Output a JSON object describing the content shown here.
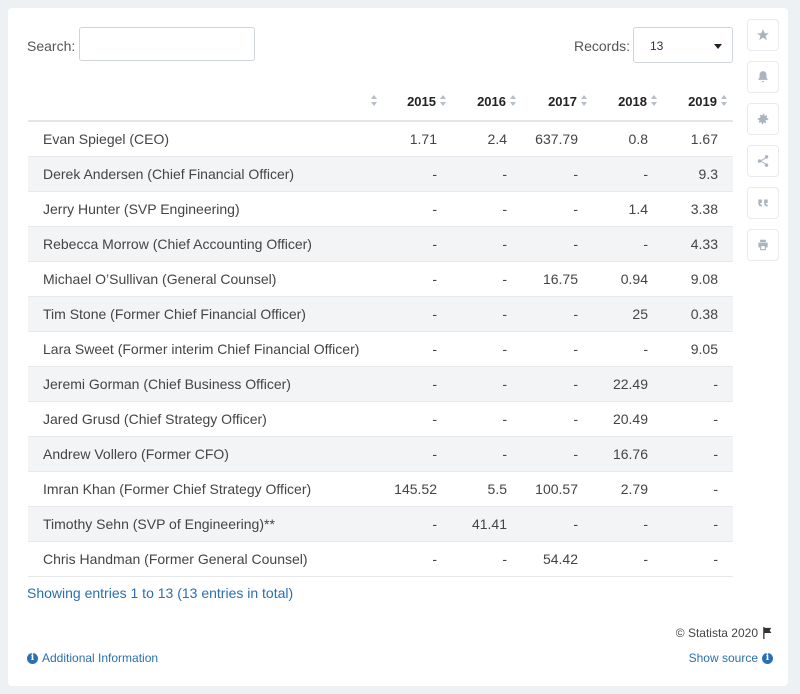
{
  "search": {
    "label": "Search:",
    "value": ""
  },
  "records": {
    "label": "Records:",
    "selected": "13"
  },
  "sidebar": {
    "icons": [
      "star-icon",
      "bell-icon",
      "gear-icon",
      "share-icon",
      "quote-icon",
      "print-icon"
    ]
  },
  "chart_data": {
    "type": "table",
    "columns": [
      "",
      "2015",
      "2016",
      "2017",
      "2018",
      "2019"
    ],
    "rows": [
      [
        "Evan Spiegel (CEO)",
        "1.71",
        "2.4",
        "637.79",
        "0.8",
        "1.67"
      ],
      [
        "Derek Andersen (Chief Financial Officer)",
        "-",
        "-",
        "-",
        "-",
        "9.3"
      ],
      [
        "Jerry Hunter (SVP Engineering)",
        "-",
        "-",
        "-",
        "1.4",
        "3.38"
      ],
      [
        "Rebecca Morrow (Chief Accounting Officer)",
        "-",
        "-",
        "-",
        "-",
        "4.33"
      ],
      [
        "Michael O’Sullivan (General Counsel)",
        "-",
        "-",
        "16.75",
        "0.94",
        "9.08"
      ],
      [
        "Tim Stone (Former Chief Financial Officer)",
        "-",
        "-",
        "-",
        "25",
        "0.38"
      ],
      [
        "Lara Sweet (Former interim Chief Financial Officer)",
        "-",
        "-",
        "-",
        "-",
        "9.05"
      ],
      [
        "Jeremi Gorman (Chief Business Officer)",
        "-",
        "-",
        "-",
        "22.49",
        "-"
      ],
      [
        "Jared Grusd (Chief Strategy Officer)",
        "-",
        "-",
        "-",
        "20.49",
        "-"
      ],
      [
        "Andrew Vollero (Former CFO)",
        "-",
        "-",
        "-",
        "16.76",
        "-"
      ],
      [
        "Imran Khan (Former Chief Strategy Officer)",
        "145.52",
        "5.5",
        "100.57",
        "2.79",
        "-"
      ],
      [
        "Timothy Sehn (SVP of Engineering)**",
        "-",
        "41.41",
        "-",
        "-",
        "-"
      ],
      [
        "Chris Handman (Former General Counsel)",
        "-",
        "-",
        "54.42",
        "-",
        "-"
      ]
    ]
  },
  "footer": {
    "showing": "Showing entries 1 to 13 (13 entries in total)",
    "copyright": "© Statista 2020",
    "additional_info": "Additional Information",
    "show_source": "Show source"
  },
  "colors": {
    "link": "#2a6fb0",
    "stripe": "#f3f4f6"
  }
}
